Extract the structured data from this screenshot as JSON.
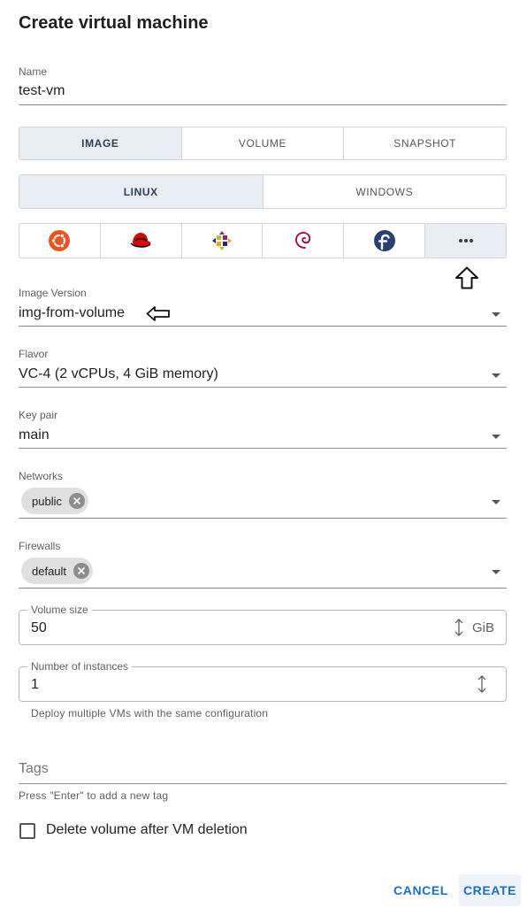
{
  "dialog": {
    "title": "Create virtual machine"
  },
  "name": {
    "label": "Name",
    "value": "test-vm"
  },
  "source_tabs": [
    "IMAGE",
    "VOLUME",
    "SNAPSHOT"
  ],
  "os_tabs": [
    "LINUX",
    "WINDOWS"
  ],
  "distro_icons": [
    "ubuntu-icon",
    "redhat-icon",
    "centos-icon",
    "debian-icon",
    "fedora-icon",
    "more-options-icon"
  ],
  "image_version": {
    "label": "Image Version",
    "value": "img-from-volume"
  },
  "flavor": {
    "label": "Flavor",
    "value": "VC-4 (2 vCPUs, 4 GiB memory)"
  },
  "key_pair": {
    "label": "Key pair",
    "value": "main"
  },
  "networks": {
    "label": "Networks",
    "chip": "public"
  },
  "firewalls": {
    "label": "Firewalls",
    "chip": "default"
  },
  "volume_size": {
    "label": "Volume size",
    "value": "50",
    "unit": "GiB"
  },
  "instances": {
    "label": "Number of instances",
    "value": "1",
    "helper": "Deploy multiple VMs with the same configuration"
  },
  "tags": {
    "placeholder": "Tags",
    "helper": "Press \"Enter\" to add a new tag"
  },
  "delete_volume": {
    "label": "Delete volume after VM deletion",
    "checked": false
  },
  "actions": {
    "cancel": "CANCEL",
    "create": "CREATE"
  },
  "colors": {
    "accent": "#1a6fc7",
    "selected_bg": "#e8edf3",
    "ubuntu": "#e95420",
    "redhat": "#e00000",
    "debian": "#a80030",
    "fedora": "#294172"
  }
}
